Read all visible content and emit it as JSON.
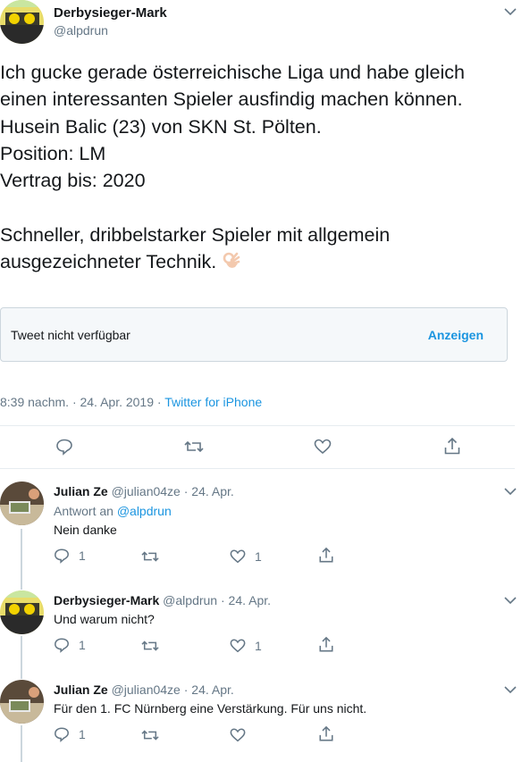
{
  "main_tweet": {
    "name": "Derbysieger-Mark",
    "handle": "@alpdrun",
    "text_lines": [
      "Ich gucke gerade österreichische Liga und habe gleich",
      "einen interessanten Spieler ausfindig machen können.",
      "Husein Balic (23) von SKN St. Pölten.",
      "Position: LM",
      "Vertrag bis: 2020",
      "",
      "Schneller, dribbelstarker Spieler mit allgemein",
      "ausgezeichneter Technik."
    ],
    "emoji_icon": "ok-hand-icon",
    "quote": {
      "text": "Tweet nicht verfügbar",
      "button": "Anzeigen"
    },
    "timestamp": "8:39 nachm. · 24. Apr. 2019 · ",
    "source": "Twitter for iPhone"
  },
  "replies": [
    {
      "name": "Julian Ze",
      "handle_date": "@julian04ze · 24. Apr.",
      "reply_to_prefix": "Antwort an ",
      "reply_to_handle": "@alpdrun",
      "text": "Nein danke",
      "reply_count": "1",
      "like_count": "1"
    },
    {
      "name": "Derbysieger-Mark",
      "handle_date": "@alpdrun · 24. Apr.",
      "text": "Und warum nicht?",
      "reply_count": "1",
      "like_count": "1"
    },
    {
      "name": "Julian Ze",
      "handle_date": "@julian04ze · 24. Apr.",
      "text": "Für den 1. FC Nürnberg eine Verstärkung. Für uns nicht.",
      "reply_count": "1",
      "like_count": ""
    }
  ],
  "colors": {
    "accent": "#1b95e0",
    "muted": "#657786",
    "border": "#ccd6dd"
  }
}
